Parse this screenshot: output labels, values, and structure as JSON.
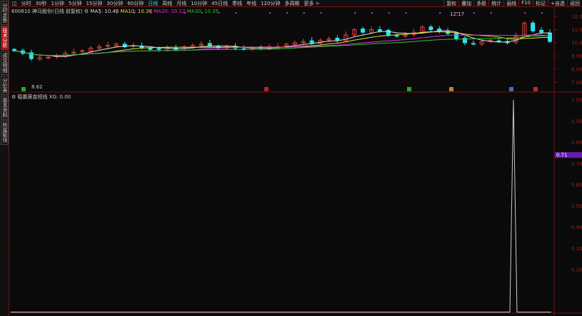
{
  "sidebar": {
    "items": [
      {
        "label": "分时走势"
      },
      {
        "label": "技术分析",
        "active": true
      },
      {
        "label": "成交明细"
      },
      {
        "label": "分价表"
      },
      {
        "label": "基本资料"
      },
      {
        "label": "所属板块"
      }
    ]
  },
  "toolbar": {
    "periods": [
      "分时",
      "30秒",
      "1分钟",
      "5分钟",
      "15分钟",
      "30分钟",
      "60分钟",
      "日线",
      "周线",
      "月线",
      "10分钟",
      "45日线",
      "季线",
      "年线",
      "120分钟",
      "多周期",
      "更多 >"
    ],
    "active": "日线",
    "right": [
      "复权",
      "叠加",
      "多股",
      "统计",
      "画线",
      "F10",
      "标记",
      "+自选",
      "返回"
    ]
  },
  "stock": {
    "code": "600810",
    "name": "神马股份",
    "mode": "(日线 前复权)",
    "ma5": "MA5: 10.46",
    "ma10": "MA10: 10.38",
    "ma20": "MA20: 10.12",
    "ma30": "MA30: 10.35"
  },
  "colors": {
    "up": "#e04040",
    "down": "#29e5f2",
    "ma5": "#dddddd",
    "ma10": "#e0e030",
    "ma20": "#e030e0",
    "ma30": "#30c030",
    "axis": "#7a0f0f",
    "indicator": "#cccccc",
    "marker_tag": "#6a1bb0"
  },
  "annotations": {
    "high": "12.17",
    "low": "8.62"
  },
  "price_axis": {
    "ticks": [
      "12.00",
      "11.00",
      "10.00",
      "9.00",
      "8.00",
      "7.00"
    ]
  },
  "indicator": {
    "name": "稳赢黄金短线",
    "value": "XG: 0.00",
    "ticks": [
      "1.00",
      "0.90",
      "0.80",
      "0.70",
      "0.60",
      "0.50",
      "0.40",
      "0.30",
      "0.20"
    ],
    "current_tag": "0.71",
    "signal_peak": 1.0
  },
  "chart_data": {
    "type": "candlestick",
    "ylim": [
      7,
      12.2
    ],
    "closes": [
      9.4,
      9.2,
      8.8,
      8.9,
      8.9,
      9.0,
      9.2,
      9.3,
      9.4,
      9.6,
      9.7,
      9.8,
      9.9,
      9.7,
      9.8,
      9.6,
      9.5,
      9.5,
      9.6,
      9.5,
      9.7,
      9.8,
      9.9,
      9.8,
      9.6,
      9.7,
      9.6,
      9.5,
      9.6,
      9.6,
      9.7,
      9.7,
      9.9,
      10.0,
      10.1,
      10.0,
      10.2,
      10.3,
      10.2,
      10.6,
      11.0,
      10.8,
      11.0,
      10.9,
      10.6,
      10.5,
      10.6,
      10.8,
      11.2,
      11.0,
      10.9,
      10.7,
      10.3,
      10.0,
      9.9,
      10.1,
      10.2,
      10.1,
      10.0,
      10.5,
      11.5,
      10.9,
      10.8,
      10.1
    ]
  }
}
